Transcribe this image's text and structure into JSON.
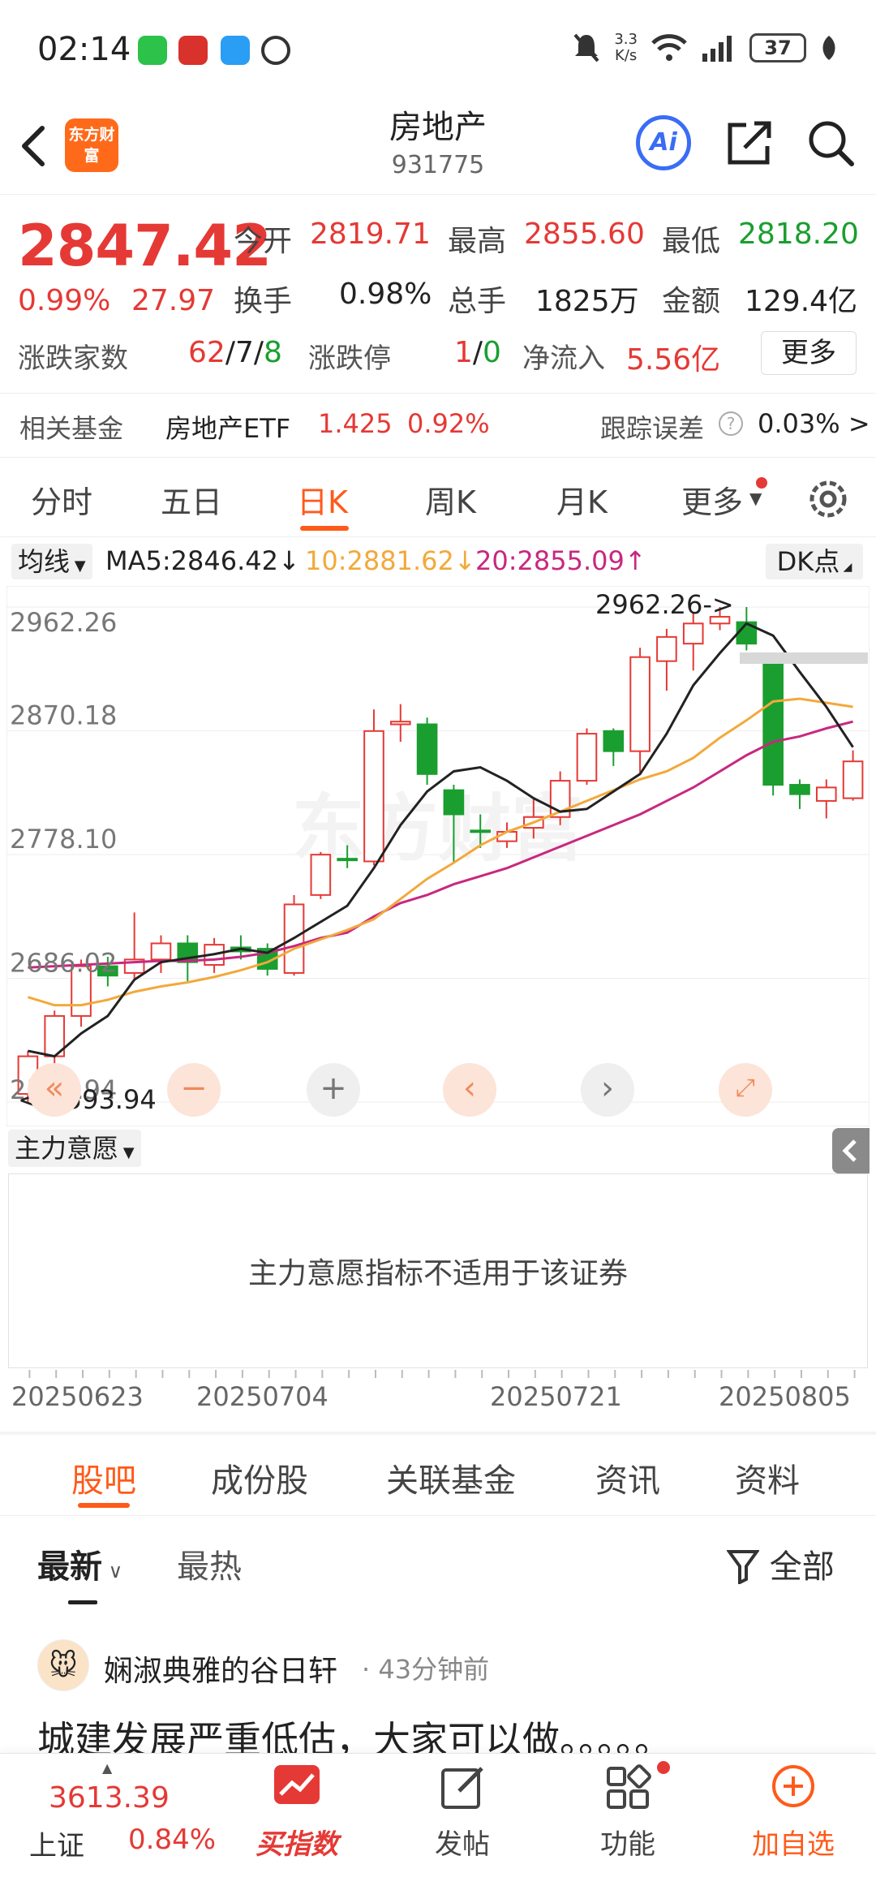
{
  "status_bar": {
    "time": "02:14",
    "net_speed": "3.3\nK/s",
    "battery": "37"
  },
  "header": {
    "title": "房地产",
    "code": "931775",
    "logo": "东方财富",
    "ai_label": "Ai"
  },
  "quote": {
    "price": "2847.42",
    "change_pct": "0.99%",
    "change_abs": "27.97",
    "open_label": "今开",
    "open": "2819.71",
    "high_label": "最高",
    "high": "2855.60",
    "low_label": "最低",
    "low": "2818.20",
    "turnover_label": "换手",
    "turnover": "0.98%",
    "volume_label": "总手",
    "volume": "1825万",
    "amount_label": "金额",
    "amount": "129.4亿",
    "breadth_label": "涨跌家数",
    "breadth_up": "62",
    "sep1": "/",
    "breadth_flat": "7",
    "sep2": "/",
    "breadth_down": "8",
    "limit_label": "涨跌停",
    "limit_up": "1",
    "sep3": "/",
    "limit_down": "0",
    "netflow_label": "净流入",
    "netflow": "5.56亿",
    "more_label": "更多"
  },
  "fund": {
    "label": "相关基金",
    "name": "房地产ETF",
    "price": "1.425",
    "pct": "0.92%",
    "tracking_label": "跟踪误差",
    "tracking": "0.03% >"
  },
  "period_tabs": [
    "分时",
    "五日",
    "日K",
    "周K",
    "月K",
    "更多"
  ],
  "active_period": "日K",
  "ma": {
    "selector": "均线",
    "ma5": "MA5:2846.42↓",
    "ma10": "10:2881.62↓",
    "ma20": "20:2855.09↑",
    "dk": "DK点"
  },
  "colors": {
    "up": "#e53935",
    "down": "#1a9e2f",
    "ma5": "#222222",
    "ma10": "#f2a93b",
    "ma20": "#c8287f",
    "accent": "#ff5a1a"
  },
  "chart_data": {
    "type": "candlestick",
    "y_ticks": [
      "2962.26",
      "2870.18",
      "2778.10",
      "2686.02",
      "2593.94"
    ],
    "ylim": [
      2593.94,
      2962.26
    ],
    "max_marker": "2962.26->",
    "min_marker": "<-2593.94",
    "watermark": "东方财富",
    "candles": [
      {
        "o": 2600,
        "c": 2628,
        "h": 2632,
        "l": 2593.94
      },
      {
        "o": 2628,
        "c": 2658,
        "h": 2662,
        "l": 2620
      },
      {
        "o": 2658,
        "c": 2695,
        "h": 2700,
        "l": 2650
      },
      {
        "o": 2695,
        "c": 2688,
        "h": 2702,
        "l": 2680
      },
      {
        "o": 2690,
        "c": 2700,
        "h": 2735,
        "l": 2686
      },
      {
        "o": 2700,
        "c": 2712,
        "h": 2718,
        "l": 2690
      },
      {
        "o": 2712,
        "c": 2698,
        "h": 2718,
        "l": 2684
      },
      {
        "o": 2696,
        "c": 2711,
        "h": 2716,
        "l": 2690
      },
      {
        "o": 2709,
        "c": 2706,
        "h": 2718,
        "l": 2700
      },
      {
        "o": 2708,
        "c": 2693,
        "h": 2712,
        "l": 2688
      },
      {
        "o": 2690,
        "c": 2741,
        "h": 2748,
        "l": 2688
      },
      {
        "o": 2748,
        "c": 2778,
        "h": 2780,
        "l": 2745
      },
      {
        "o": 2775,
        "c": 2774,
        "h": 2785,
        "l": 2768
      },
      {
        "o": 2773,
        "c": 2870,
        "h": 2886,
        "l": 2770
      },
      {
        "o": 2875,
        "c": 2877,
        "h": 2890,
        "l": 2862
      },
      {
        "o": 2875,
        "c": 2838,
        "h": 2880,
        "l": 2830
      },
      {
        "o": 2826,
        "c": 2808,
        "h": 2830,
        "l": 2772
      },
      {
        "o": 2796,
        "c": 2795,
        "h": 2808,
        "l": 2783
      },
      {
        "o": 2788,
        "c": 2795,
        "h": 2802,
        "l": 2783
      },
      {
        "o": 2798,
        "c": 2806,
        "h": 2820,
        "l": 2790
      },
      {
        "o": 2806,
        "c": 2833,
        "h": 2840,
        "l": 2800
      },
      {
        "o": 2833,
        "c": 2868,
        "h": 2872,
        "l": 2830
      },
      {
        "o": 2870,
        "c": 2855,
        "h": 2872,
        "l": 2844
      },
      {
        "o": 2855,
        "c": 2925,
        "h": 2932,
        "l": 2838
      },
      {
        "o": 2922,
        "c": 2940,
        "h": 2946,
        "l": 2900
      },
      {
        "o": 2935,
        "c": 2950,
        "h": 2958,
        "l": 2915
      },
      {
        "o": 2950,
        "c": 2955,
        "h": 2962.26,
        "l": 2945
      },
      {
        "o": 2951,
        "c": 2935,
        "h": 2962.26,
        "l": 2930
      },
      {
        "o": 2920,
        "c": 2830,
        "h": 2925,
        "l": 2822
      },
      {
        "o": 2830,
        "c": 2823,
        "h": 2834,
        "l": 2812
      },
      {
        "o": 2818,
        "c": 2828,
        "h": 2834,
        "l": 2805
      },
      {
        "o": 2820,
        "c": 2847.42,
        "h": 2855.6,
        "l": 2818.2
      }
    ],
    "ma5": [
      2632,
      2628,
      2645,
      2658,
      2685,
      2698,
      2701,
      2704,
      2708,
      2705,
      2716,
      2728,
      2740,
      2768,
      2800,
      2825,
      2840,
      2843,
      2833,
      2820,
      2810,
      2812,
      2825,
      2838,
      2868,
      2904,
      2928,
      2950,
      2941,
      2914,
      2888,
      2858
    ],
    "ma10": [
      2672,
      2666,
      2666,
      2670,
      2676,
      2680,
      2683,
      2687,
      2692,
      2698,
      2708,
      2715,
      2722,
      2730,
      2745,
      2760,
      2772,
      2785,
      2795,
      2802,
      2810,
      2818,
      2826,
      2834,
      2840,
      2850,
      2865,
      2878,
      2892,
      2894,
      2891,
      2888
    ],
    "ma20": [
      2694,
      2695,
      2696,
      2697,
      2698,
      2699,
      2699,
      2700,
      2702,
      2705,
      2710,
      2716,
      2720,
      2732,
      2742,
      2748,
      2756,
      2762,
      2768,
      2776,
      2784,
      2792,
      2800,
      2808,
      2818,
      2828,
      2840,
      2852,
      2862,
      2866,
      2872,
      2877
    ]
  },
  "indicator": {
    "selector": "主力意愿",
    "message": "主力意愿指标不适用于该证券"
  },
  "dates": [
    "20250623",
    "20250704",
    "20250721",
    "20250805"
  ],
  "content_tabs": [
    "股吧",
    "成份股",
    "关联基金",
    "资讯",
    "资料"
  ],
  "sort": {
    "latest": "最新",
    "hot": "最热",
    "filter": "全部"
  },
  "post": {
    "user": "娴淑典雅的谷日轩",
    "time": "· 43分钟前",
    "text": "城建发展严重低估，大家可以做。。。。。"
  },
  "bottom_bar": {
    "index_value": "3613.39",
    "index_name": "上证",
    "index_change": "0.84%",
    "buy_index": "买指数",
    "post": "发帖",
    "functions": "功能",
    "add_watch": "加自选"
  }
}
